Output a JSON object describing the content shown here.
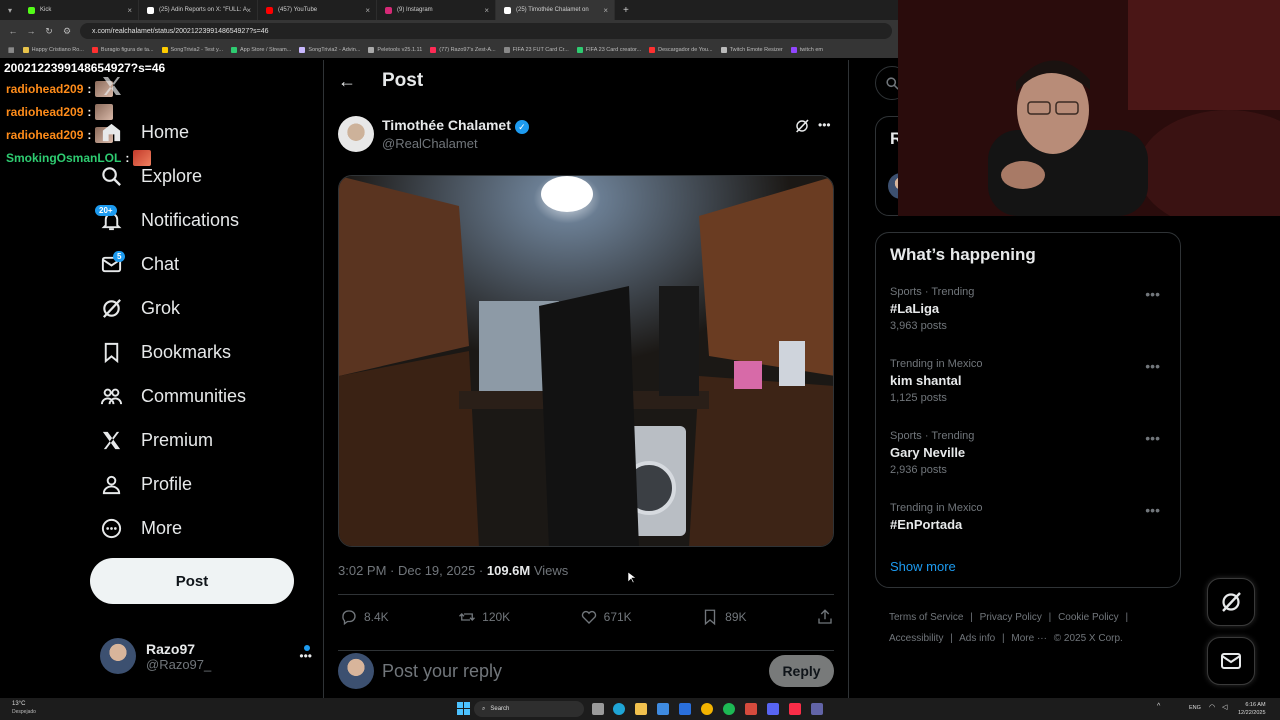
{
  "browser": {
    "tabs": [
      {
        "title": "Kick",
        "color": "#53fc18",
        "active": false
      },
      {
        "title": "(25) Adin Reports on X: \"FULL: A",
        "color": "#ffffff",
        "active": false
      },
      {
        "title": "(457) YouTube",
        "color": "#ff0000",
        "active": false
      },
      {
        "title": "(9) Instagram",
        "color": "#d62976",
        "active": false
      },
      {
        "title": "(25) Timothée Chalamet on",
        "color": "#ffffff",
        "active": true
      }
    ],
    "new_tab": "+",
    "url": "x.com/realchalamet/status/2002122399148654927?s=46",
    "bookmarks": [
      "Happy Cristiano Ro...",
      "Buragio figura de ta...",
      "SongTrivia2 - Test y...",
      "App Store / Stream...",
      "SongTrivia2 - Advin...",
      "Peletools v25.1.11",
      "(77) Razo97's Zest-A...",
      "FIFA 23 FUT Card Cr...",
      "FIFA 23 Card creator...",
      "Descargador de You...",
      "Twitch Emote Resizer",
      "twitch em"
    ]
  },
  "overlay": {
    "status_id": "2002122399148654927?s=46",
    "chat": [
      {
        "user": "radiohead209",
        "sep": ":",
        "color": "#ff8c1a"
      },
      {
        "user": "radiohead209",
        "sep": ":",
        "color": "#ff8c1a"
      },
      {
        "user": "radiohead209",
        "sep": ":",
        "color": "#ff8c1a"
      },
      {
        "user": "SmokingOsmanLOL",
        "sep": ":",
        "color": "#2ecc71"
      }
    ]
  },
  "sidebar": {
    "items": [
      {
        "label": "Home",
        "icon": "home-icon"
      },
      {
        "label": "Explore",
        "icon": "search-icon"
      },
      {
        "label": "Notifications",
        "icon": "bell-icon",
        "badge": "20+"
      },
      {
        "label": "Chat",
        "icon": "mail-icon",
        "badge": "5"
      },
      {
        "label": "Grok",
        "icon": "grok-icon"
      },
      {
        "label": "Bookmarks",
        "icon": "bookmark-icon"
      },
      {
        "label": "Communities",
        "icon": "people-icon"
      },
      {
        "label": "Premium",
        "icon": "x-logo-icon"
      },
      {
        "label": "Profile",
        "icon": "person-icon"
      },
      {
        "label": "More",
        "icon": "more-circle-icon"
      }
    ],
    "post_button": "Post",
    "account": {
      "name": "Razo97",
      "handle": "@Razo97_",
      "more": "•••"
    }
  },
  "main": {
    "header": "Post",
    "author": {
      "name": "Timothée Chalamet",
      "handle": "@RealChalamet"
    },
    "meta": {
      "time": "3:02 PM · Dec 19, 2025 · ",
      "views": "109.6M",
      "views_label": " Views"
    },
    "actions": {
      "replies": "8.4K",
      "reposts": "120K",
      "likes": "671K",
      "bookmarks": "89K"
    },
    "reply_placeholder": "Post your reply",
    "reply_button": "Reply"
  },
  "right": {
    "premium_letter": "R",
    "trends_title": "What’s happening",
    "trends": [
      {
        "context": "Sports · Trending",
        "name": "#LaLiga",
        "count": "3,963 posts"
      },
      {
        "context": "Trending in Mexico",
        "name": "kim shantal",
        "count": "1,125 posts"
      },
      {
        "context": "Sports · Trending",
        "name": "Gary Neville",
        "count": "2,936 posts"
      },
      {
        "context": "Trending in Mexico",
        "name": "#EnPortada",
        "count": ""
      }
    ],
    "show_more": "Show more",
    "footer": [
      "Terms of Service",
      "|",
      "Privacy Policy",
      "|",
      "Cookie Policy",
      "|",
      "Accessibility",
      "|",
      "Ads info",
      "|",
      "More ···",
      "© 2025 X Corp."
    ]
  },
  "taskbar": {
    "weather_temp": "13°C",
    "weather_desc": "Despejado",
    "search": "Search",
    "lang": "ENG",
    "time": "6:16 AM",
    "date": "12/22/2025"
  },
  "colors": {
    "accent": "#1d9bf0",
    "background": "#000000",
    "border": "#2f3336",
    "muted": "#71767b"
  }
}
